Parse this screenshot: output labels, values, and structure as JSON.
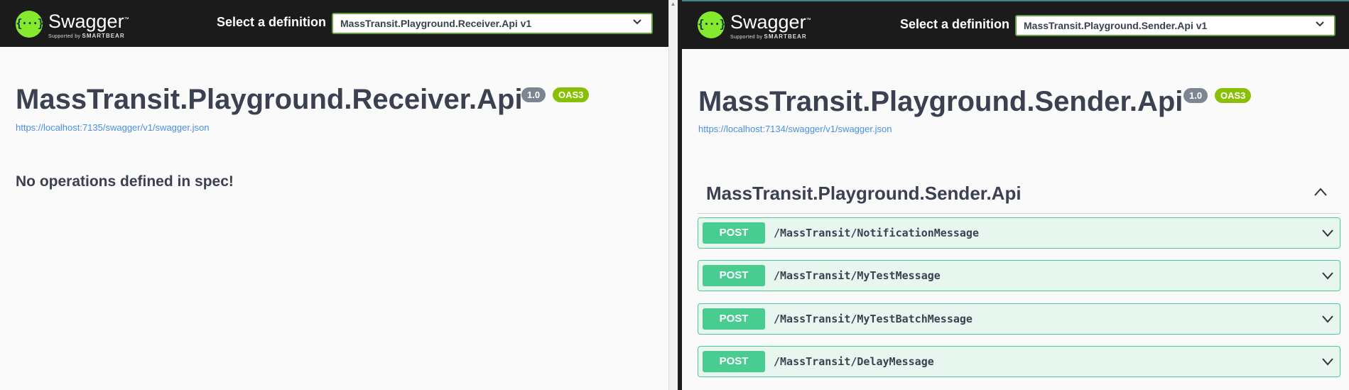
{
  "left": {
    "logo": {
      "name": "Swagger",
      "tm": "™",
      "sub_prefix": "Supported by",
      "sub_brand": "SMARTBEAR",
      "glyph": "{···}"
    },
    "definition_label": "Select a definition",
    "definition_value": "MassTransit.Playground.Receiver.Api v1",
    "title": "MassTransit.Playground.Receiver.Api",
    "version_badge": "1.0",
    "oas_badge": "OAS3",
    "spec_url": "https://localhost:7135/swagger/v1/swagger.json",
    "message": "No operations defined in spec!"
  },
  "right": {
    "logo": {
      "name": "Swagger",
      "tm": "™",
      "sub_prefix": "Supported by",
      "sub_brand": "SMARTBEAR",
      "glyph": "{···}"
    },
    "definition_label": "Select a definition",
    "definition_value": "MassTransit.Playground.Sender.Api v1",
    "title": "MassTransit.Playground.Sender.Api",
    "version_badge": "1.0",
    "oas_badge": "OAS3",
    "spec_url": "https://localhost:7134/swagger/v1/swagger.json",
    "tag": "MassTransit.Playground.Sender.Api",
    "operations": [
      {
        "method": "POST",
        "path": "/MassTransit/NotificationMessage"
      },
      {
        "method": "POST",
        "path": "/MassTransit/MyTestMessage"
      },
      {
        "method": "POST",
        "path": "/MassTransit/MyTestBatchMessage"
      },
      {
        "method": "POST",
        "path": "/MassTransit/DelayMessage"
      }
    ]
  },
  "colors": {
    "topbar": "#1b1b1b",
    "post": "#49cc90",
    "oas": "#89bf04",
    "version": "#7d8492",
    "link": "#4990e2"
  },
  "scroll_glyph": "▲"
}
